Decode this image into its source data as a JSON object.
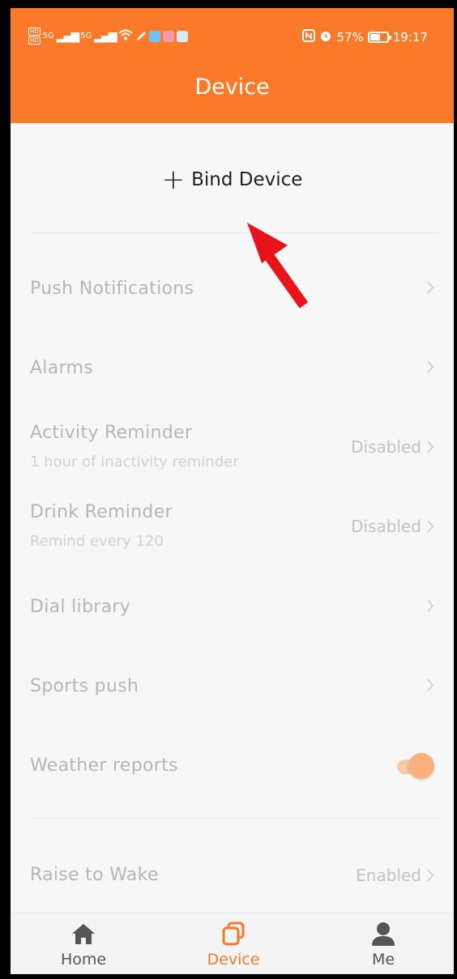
{
  "status": {
    "left_badges": [
      "HD",
      "HD"
    ],
    "signal_1": "5G",
    "signal_2": "5G",
    "battery_pct": "57%",
    "time": "19:17",
    "battery_level": 0.57
  },
  "header": {
    "title": "Device"
  },
  "bind": {
    "label": "Bind Device"
  },
  "settings": {
    "push_notifications": {
      "label": "Push Notifications"
    },
    "alarms": {
      "label": "Alarms"
    },
    "activity_reminder": {
      "label": "Activity Reminder",
      "sub": "1 hour of inactivity reminder",
      "value": "Disabled"
    },
    "drink_reminder": {
      "label": "Drink Reminder",
      "sub": "Remind every 120",
      "value": "Disabled"
    },
    "dial_library": {
      "label": "Dial library"
    },
    "sports_push": {
      "label": "Sports push"
    },
    "weather_reports": {
      "label": "Weather reports",
      "enabled": true
    },
    "raise_to_wake": {
      "label": "Raise to Wake",
      "value": "Enabled"
    }
  },
  "tabs": {
    "home": "Home",
    "device": "Device",
    "me": "Me",
    "active": "device"
  },
  "colors": {
    "brand": "#fb7a29",
    "annotation_arrow": "#e8141b"
  }
}
